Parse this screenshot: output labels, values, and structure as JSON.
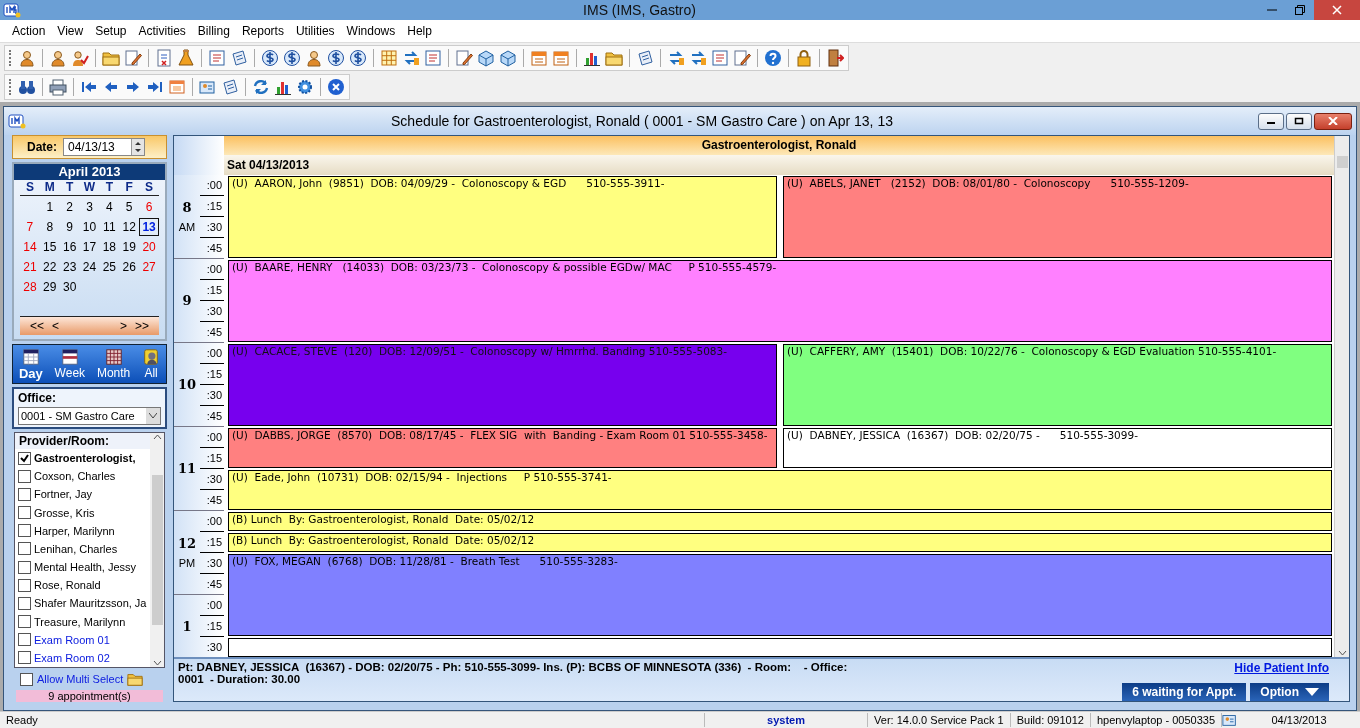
{
  "app": {
    "title": "IMS (IMS, Gastro)"
  },
  "menu": [
    "Action",
    "View",
    "Setup",
    "Activities",
    "Billing",
    "Reports",
    "Utilities",
    "Windows",
    "Help"
  ],
  "schedule_window": {
    "title": "Schedule for Gastroenterologist, Ronald ( 0001 - SM Gastro Care )  on  Apr 13, 13"
  },
  "date_picker": {
    "label": "Date:",
    "value": "04/13/13"
  },
  "calendar": {
    "month": "April 2013",
    "weekdays": [
      "S",
      "M",
      "T",
      "W",
      "T",
      "F",
      "S"
    ],
    "weeks": [
      [
        {
          "d": "1",
          "selected": false
        },
        {
          "d": "2",
          "selected": false
        },
        {
          "d": "3",
          "selected": false
        },
        {
          "d": "4",
          "selected": false
        },
        {
          "d": "5",
          "selected": false
        },
        {
          "d": "6",
          "selected": false
        }
      ],
      [
        {
          "d": "7",
          "selected": false
        },
        {
          "d": "8",
          "selected": false
        },
        {
          "d": "9",
          "selected": false
        },
        {
          "d": "10",
          "selected": false
        },
        {
          "d": "11",
          "selected": false
        },
        {
          "d": "12",
          "selected": false
        },
        {
          "d": "13",
          "selected": true
        }
      ],
      [
        {
          "d": "14",
          "selected": false
        },
        {
          "d": "15",
          "selected": false
        },
        {
          "d": "16",
          "selected": false
        },
        {
          "d": "17",
          "selected": false
        },
        {
          "d": "18",
          "selected": false
        },
        {
          "d": "19",
          "selected": false
        },
        {
          "d": "20",
          "selected": false
        }
      ],
      [
        {
          "d": "21",
          "selected": false
        },
        {
          "d": "22",
          "selected": false
        },
        {
          "d": "23",
          "selected": false
        },
        {
          "d": "24",
          "selected": false
        },
        {
          "d": "25",
          "selected": false
        },
        {
          "d": "26",
          "selected": false
        },
        {
          "d": "27",
          "selected": false
        }
      ],
      [
        {
          "d": "28",
          "selected": false
        },
        {
          "d": "29",
          "selected": false
        },
        {
          "d": "30",
          "selected": false
        }
      ]
    ],
    "nav": [
      "<<",
      "<",
      ">",
      ">>"
    ]
  },
  "views": [
    {
      "label": "Day",
      "selected": true
    },
    {
      "label": "Week",
      "selected": false
    },
    {
      "label": "Month",
      "selected": false
    },
    {
      "label": "All",
      "selected": false
    }
  ],
  "office": {
    "label": "Office:",
    "value": "0001 - SM Gastro Care"
  },
  "providers": {
    "heading": "Provider/Room:",
    "items": [
      {
        "name": "Gastroenterologist,",
        "kind": "provider",
        "checked": true
      },
      {
        "name": "Coxson, Charles",
        "kind": "provider",
        "checked": false
      },
      {
        "name": "Fortner, Jay",
        "kind": "provider",
        "checked": false
      },
      {
        "name": "Grosse, Kris",
        "kind": "provider",
        "checked": false
      },
      {
        "name": "Harper, Marilynn",
        "kind": "provider",
        "checked": false
      },
      {
        "name": "Lenihan, Charles",
        "kind": "provider",
        "checked": false
      },
      {
        "name": "Mental Health, Jessy",
        "kind": "provider",
        "checked": false
      },
      {
        "name": "Rose, Ronald",
        "kind": "provider",
        "checked": false
      },
      {
        "name": "Shafer Mauritzsson, Ja",
        "kind": "provider",
        "checked": false
      },
      {
        "name": "Treasure, Marilynn",
        "kind": "provider",
        "checked": false
      },
      {
        "name": "Exam Room 01",
        "kind": "room",
        "checked": false
      },
      {
        "name": "Exam Room 02",
        "kind": "room",
        "checked": false
      }
    ]
  },
  "multi_select": {
    "label": "Allow Multi Select",
    "checked": false
  },
  "appointment_count": "9 appointment(s)",
  "schedule": {
    "provider": "Gastroenterologist, Ronald",
    "date": "Sat 04/13/2013",
    "hours": [
      {
        "hour": "8",
        "period": "AM",
        "minutes": [
          ":00",
          ":15",
          ":30",
          ":45"
        ]
      },
      {
        "hour": "9",
        "minutes": [
          ":00",
          ":15",
          ":30",
          ":45"
        ]
      },
      {
        "hour": "10",
        "minutes": [
          ":00",
          ":15",
          ":30",
          ":45"
        ]
      },
      {
        "hour": "11",
        "minutes": [
          ":00",
          ":15",
          ":30",
          ":45"
        ]
      },
      {
        "hour": "12",
        "period": "PM",
        "minutes": [
          ":00",
          ":15",
          ":30",
          ":45"
        ]
      },
      {
        "hour": "1",
        "minutes": [
          ":00",
          ":15",
          ":30"
        ]
      }
    ],
    "appointments": [
      {
        "text": "(U)  AARON, John  (9851)  DOB: 04/09/29 -  Colonoscopy & EGD      510-555-3911-",
        "kind": "hour-left",
        "color": "#ffff80"
      },
      {
        "text": "(U)  ABELS, JANET   (2152)  DOB: 08/01/80 -  Colonoscopy      510-555-1209-",
        "kind": "hour-right",
        "color": "#ff8080"
      },
      {
        "text": "(U)  BAARE, HENRY   (14033)  DOB: 03/23/73 -  Colonoscopy & possible EGDw/ MAC     P 510-555-4579-",
        "kind": "hour-full",
        "color": "#ff80ff"
      },
      {
        "text": "(U)  CACACE, STEVE  (120)  DOB: 12/09/51 -  Colonoscopy w/ Hmrrhd. Banding 510-555-5083-",
        "kind": "hour-left",
        "color": "#7700ee"
      },
      {
        "text": "(U)  CAFFERY, AMY  (15401)  DOB: 10/22/76 -  Colonoscopy & EGD Evaluation 510-555-4101-",
        "kind": "hour-right",
        "color": "#80ff80"
      },
      {
        "text": "(U)  DABBS, JORGE  (8570)  DOB: 08/17/45 -  FLEX SIG  with  Banding - Exam Room 01 510-555-3458-",
        "kind": "half-left",
        "color": "#ff8080"
      },
      {
        "text": "(U)  DABNEY, JESSICA  (16367)  DOB: 02/20/75 -      510-555-3099-",
        "kind": "half-right",
        "color": "#ffffff"
      },
      {
        "text": "(U)  Eade, John  (10731)  DOB: 02/15/94 -  Injections     P 510-555-3741-",
        "kind": "half-full",
        "color": "#ffff80"
      },
      {
        "text": "(B) Lunch  By: Gastroenterologist, Ronald  Date: 05/02/12",
        "kind": "quarter-full",
        "color": "#ffff80"
      },
      {
        "text": "(B) Lunch  By: Gastroenterologist, Ronald  Date: 05/02/12",
        "kind": "quarter-full",
        "color": "#ffff80"
      },
      {
        "text": "(U)  FOX, MEGAN  (6768)  DOB: 11/28/81 -  Breath Test      510-555-3283-",
        "kind": "hour-full",
        "color": "#8080ff"
      }
    ]
  },
  "patient_info": {
    "lines": [
      "Pt: DABNEY, JESSICA  (16367) - DOB: 02/20/75 - Ph: 510-555-3099- Ins. (P): BCBS OF MINNESOTA (336)  - Room:    - Office:",
      "0001  - Duration: 30.00"
    ],
    "hide_link": "Hide Patient Info",
    "waiting_button": "6 waiting for Appt.",
    "option_button": "Option"
  },
  "status_bar": [
    "Ready",
    "system",
    "Ver: 14.0.0 Service Pack 1",
    "Build: 091012",
    "hpenvylaptop - 0050335",
    "04/13/2013"
  ]
}
